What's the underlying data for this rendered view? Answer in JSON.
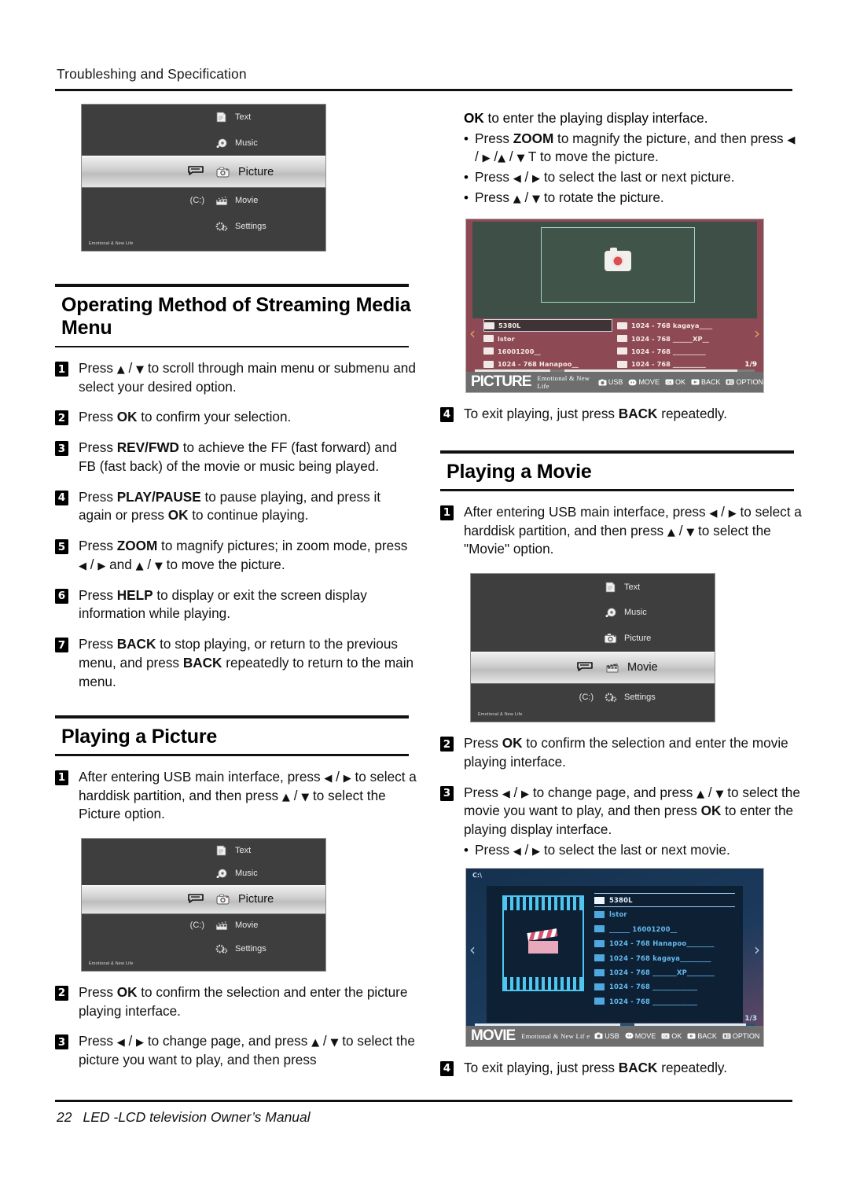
{
  "page": {
    "running_head": "Troubleshing and Specification",
    "footer_page_number": "22",
    "footer_text": "LED -LCD television Owner’s Manual"
  },
  "sections": {
    "operating_method": {
      "title": "Operating Method of Streaming Media Menu",
      "steps": [
        {
          "num": "1",
          "html": "Press <span class=\"arw\">▲</span> / <span class=\"arw\">▼</span>  to scroll through main menu or submenu and select your desired option."
        },
        {
          "num": "2",
          "html": "Press <b>OK</b> to confirm your selection."
        },
        {
          "num": "3",
          "html": "Press <b>REV/FWD</b> to achieve the FF (fast forward) and FB (fast back) of the movie or music being played."
        },
        {
          "num": "4",
          "html": "Press <b>PLAY/PAUSE</b> to pause playing, and press it again or press <b>OK</b> to continue playing."
        },
        {
          "num": "5",
          "html": "Press <b>ZOOM</b> to magnify pictures; in zoom mode, press  <span class=\"arw\">◀</span> / <span class=\"arw\">▶</span>  and <span class=\"arw\">▲</span> / <span class=\"arw\">▼</span>  to move the picture."
        },
        {
          "num": "6",
          "html": "Press <b>HELP</b> to display or exit the screen display information while playing."
        },
        {
          "num": "7",
          "html": "Press <b>BACK</b> to stop playing, or return to the previous menu, and press <b>BACK</b> repeatedly to return to the main menu."
        }
      ]
    },
    "playing_a_picture": {
      "title": "Playing a Picture",
      "steps": [
        {
          "num": "1",
          "html": "After entering USB main interface, press  <span class=\"arw\">◀</span> / <span class=\"arw\">▶</span>  to select a harddisk partition, and then press <span class=\"arw\">▲</span> / <span class=\"arw\">▼</span>  to select the Picture option."
        },
        {
          "num": "2",
          "html": "Press <b>OK</b> to confirm the selection and enter the picture playing interface."
        },
        {
          "num": "3",
          "html": "Press  <span class=\"arw\">◀</span> / <span class=\"arw\">▶</span>  to change page, and press <span class=\"arw\">▲</span> / <span class=\"arw\">▼</span>  to select the picture you want to play, and then press"
        }
      ],
      "continuation": "<b>OK</b> to enter the playing display interface.",
      "bullets": [
        "Press <b>ZOOM</b> to magnify the picture, and then press <span class=\"arw\">◀</span> / <span class=\"arw\">▶</span> /<span class=\"arw\">▲</span> / <span class=\"arw\">▼</span>  T to move the picture.",
        "Press  <span class=\"arw\">◀</span> / <span class=\"arw\">▶</span>  to select the last or next picture.",
        "Press <span class=\"arw\">▲</span> / <span class=\"arw\">▼</span>  to rotate the picture."
      ],
      "final_step": {
        "num": "4",
        "html": "To exit playing, just press <b>BACK</b> repeatedly."
      }
    },
    "playing_a_movie": {
      "title": "Playing a Movie",
      "steps": [
        {
          "num": "1",
          "html": "After entering USB main interface, press  <span class=\"arw\">◀</span> / <span class=\"arw\">▶</span>  to select a harddisk partition, and then press <span class=\"arw\">▲</span> / <span class=\"arw\">▼</span>  to select the \"Movie\" option."
        },
        {
          "num": "2",
          "html": "Press <b>OK</b> to confirm the selection and enter the movie playing interface."
        },
        {
          "num": "3",
          "html": "Press  <span class=\"arw\">◀</span> / <span class=\"arw\">▶</span>  to change page, and press <span class=\"arw\">▲</span> / <span class=\"arw\">▼</span>  to select the movie you want to play, and then press <b>OK</b> to enter the playing display interface."
        }
      ],
      "bullets": [
        "Press  <span class=\"arw\">◀</span> / <span class=\"arw\">▶</span>  to select the last or next movie."
      ],
      "final_step": {
        "num": "4",
        "html": "To exit playing, just press <b>BACK</b> repeatedly."
      }
    }
  },
  "tv_menu": {
    "items": [
      "Text",
      "Music",
      "Picture",
      "Movie",
      "Settings"
    ],
    "drive_label": "(C:)",
    "brand": "Emotional & New Life",
    "selected_picture": "Picture",
    "selected_movie": "Movie"
  },
  "picture_browser": {
    "mode_label": "PICTURE",
    "brand": "Emotional & New Life",
    "preview_caption": "5380L",
    "page_indicator": "1/9",
    "left_files": [
      "5380L",
      "lstor",
      "16001200__",
      "1024 - 768  Hanapoo__"
    ],
    "right_files": [
      "1024 - 768  kagaya____",
      "1024 - 768  ______XP__",
      "1024 - 768  __________",
      "1024 - 768  __________"
    ],
    "hints": [
      "USB",
      "MOVE",
      "OK",
      "BACK",
      "OPTION"
    ]
  },
  "movie_browser": {
    "mode_label": "MOVIE",
    "brand": "Emotional & New Lif e",
    "drive_tag": "C:\\",
    "page_indicator": "1/3",
    "files": [
      "5380L",
      "lstor",
      "______    16001200__",
      "1024 - 768  Hanapoo________",
      "1024 - 768  kagaya_________",
      "1024 - 768  _______XP________",
      "1024 - 768  _____________",
      "1024 - 768  _____________"
    ],
    "hints": [
      "USB",
      "MOVE",
      "OK",
      "BACK",
      "OPTION"
    ]
  }
}
